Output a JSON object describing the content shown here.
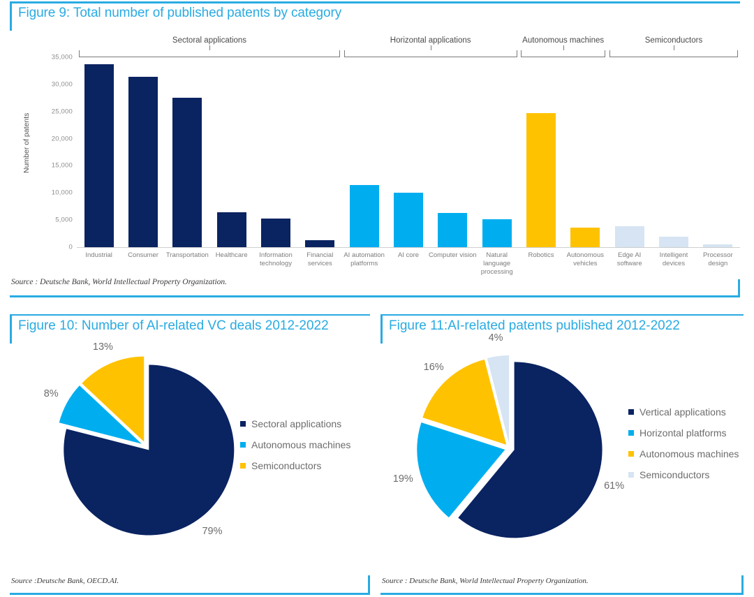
{
  "figure9": {
    "title": "Figure 9: Total number of published patents by category",
    "source": "Source : Deutsche Bank, World Intellectual Property Organization.",
    "groups": [
      {
        "label": "Sectoral applications",
        "start": 0,
        "end": 5
      },
      {
        "label": "Horizontal applications",
        "start": 6,
        "end": 9
      },
      {
        "label": "Autonomous machines",
        "start": 10,
        "end": 11
      },
      {
        "label": "Semiconductors",
        "start": 12,
        "end": 14
      }
    ]
  },
  "figure10": {
    "title": "Figure 10: Number of AI-related VC deals 2012-2022",
    "source": "Source :Deutsche Bank, OECD.AI."
  },
  "figure11": {
    "title": "Figure 11:AI-related patents published 2012-2022",
    "source": "Source : Deutsche Bank, World Intellectual Property Organization."
  },
  "colors": {
    "navy": "#0a2361",
    "cyan": "#00AEEF",
    "gold": "#FFC200",
    "pale": "#d6e4f3",
    "accent": "#29ABE2",
    "axis": "#cfcfcf"
  },
  "chart_data": [
    {
      "type": "bar",
      "title": "Figure 9: Total number of published patents by category",
      "xlabel": "",
      "ylabel": "Number of patents",
      "ylim": [
        0,
        35000
      ],
      "yticks": [
        0,
        5000,
        10000,
        15000,
        20000,
        25000,
        30000,
        35000
      ],
      "ytick_labels": [
        "0",
        "5,000",
        "10,000",
        "15,000",
        "20,000",
        "25,000",
        "30,000",
        "35,000"
      ],
      "grid": false,
      "legend": "none",
      "categories": [
        "Industrial",
        "Consumer",
        "Transportation",
        "Healthcare",
        "Information technology",
        "Financial services",
        "AI automation platforms",
        "AI core",
        "Computer vision",
        "Natural language processing",
        "Robotics",
        "Autonomous vehicles",
        "Edge AI software",
        "Intelligent devices",
        "Processor design"
      ],
      "values": [
        33700,
        31400,
        27600,
        6500,
        5300,
        1300,
        11400,
        10100,
        6300,
        5100,
        24700,
        3600,
        3800,
        1900,
        500
      ],
      "bar_colors": [
        "#0a2361",
        "#0a2361",
        "#0a2361",
        "#0a2361",
        "#0a2361",
        "#0a2361",
        "#00AEEF",
        "#00AEEF",
        "#00AEEF",
        "#00AEEF",
        "#FFC200",
        "#FFC200",
        "#d6e4f3",
        "#d6e4f3",
        "#d6e4f3"
      ],
      "group_brackets": [
        "Sectoral applications",
        "Horizontal applications",
        "Autonomous machines",
        "Semiconductors"
      ]
    },
    {
      "type": "pie",
      "title": "Figure 10: Number of AI-related VC deals 2012-2022",
      "legend": "right",
      "labels": [
        "Sectoral applications",
        "Autonomous machines",
        "Semiconductors"
      ],
      "values": [
        79,
        8,
        13
      ],
      "value_labels": [
        "79%",
        "8%",
        "13%"
      ],
      "colors": [
        "#0a2361",
        "#00AEEF",
        "#FFC200"
      ]
    },
    {
      "type": "pie",
      "title": "Figure 11:AI-related patents published 2012-2022",
      "legend": "right",
      "labels": [
        "Vertical applications",
        "Horizontal platforms",
        "Autonomous machines",
        "Semiconductors"
      ],
      "values": [
        61,
        19,
        16,
        4
      ],
      "value_labels": [
        "61%",
        "19%",
        "16%",
        "4%"
      ],
      "colors": [
        "#0a2361",
        "#00AEEF",
        "#FFC200",
        "#d6e4f3"
      ]
    }
  ]
}
